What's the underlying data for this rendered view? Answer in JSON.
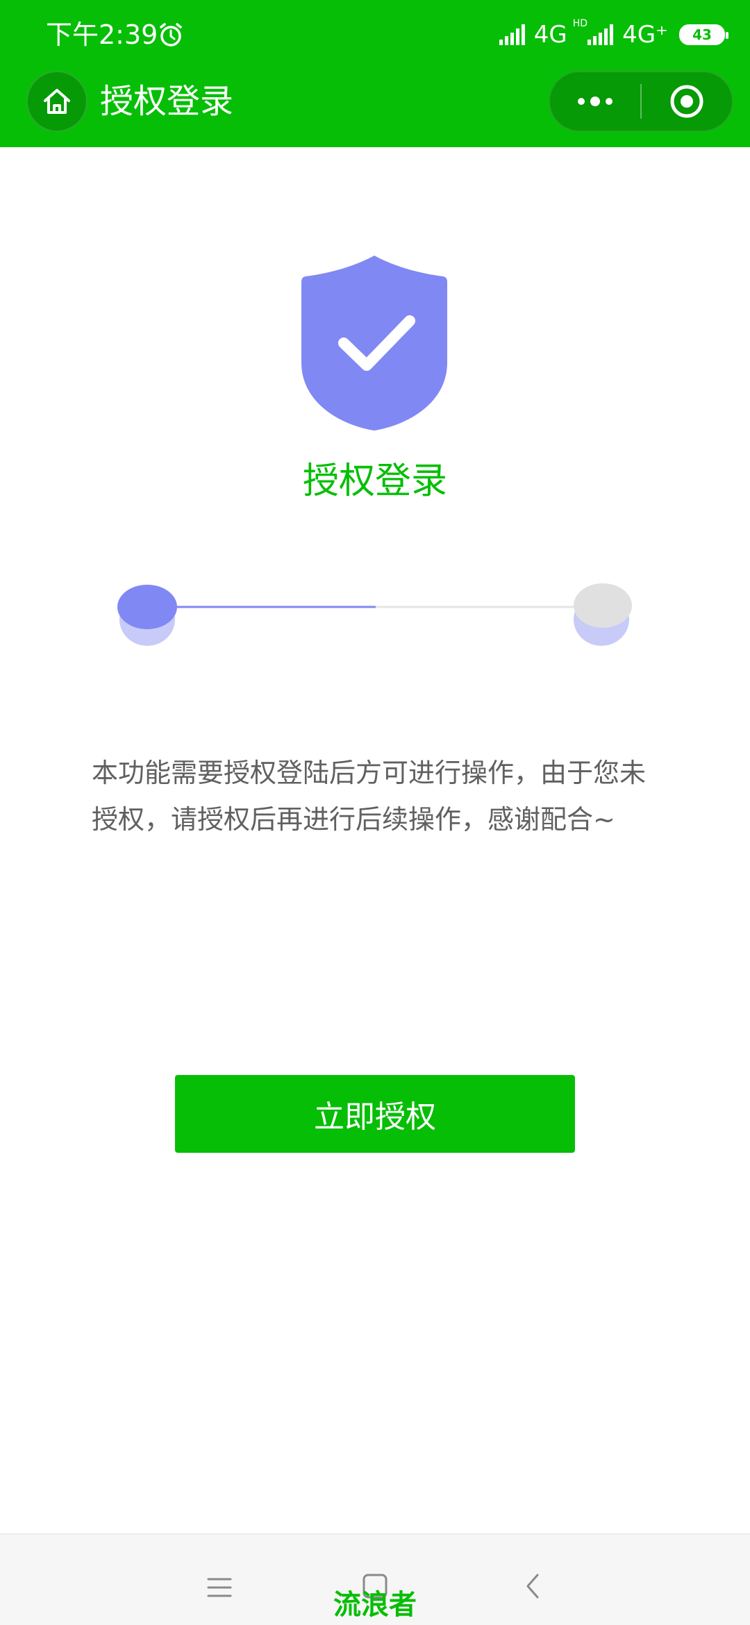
{
  "status_bar": {
    "time": "下午2:39",
    "network_1": "4G",
    "hd_tag": "HD",
    "network_2": "4G⁺",
    "battery": "43"
  },
  "navbar": {
    "title": "授权登录",
    "more_icon": "more-dots-icon",
    "close_icon": "target-circle-icon"
  },
  "main": {
    "shield_icon": "shield-check-icon",
    "title": "授权登录",
    "progress_fraction": 0.5,
    "description": "本功能需要授权登陆后方可进行操作，由于您未授权，请授权后再进行后续操作，感谢配合~",
    "authorize_button": "立即授权"
  },
  "system_nav": {
    "menu_icon": "menu-lines-icon",
    "home_icon": "square-home-icon",
    "back_icon": "chevron-left-icon"
  },
  "watermark": "流浪者",
  "colors": {
    "brand_green": "#07BE07",
    "dark_green": "#069A06",
    "accent_purple": "#8088F4",
    "light_purple": "#C8CBF8",
    "gray_dot": "#E0E0E0",
    "text_gray": "#606060"
  }
}
